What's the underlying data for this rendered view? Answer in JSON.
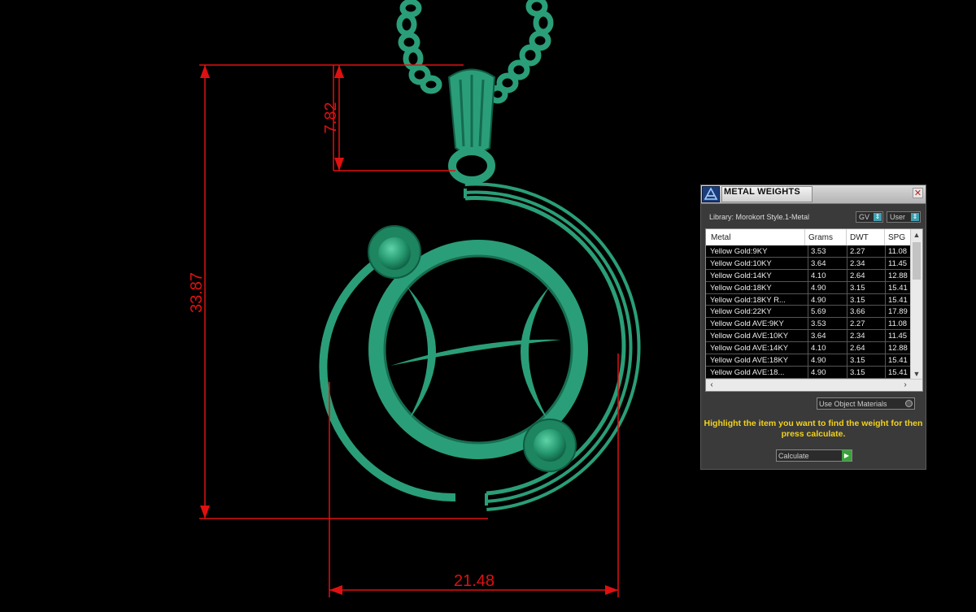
{
  "dimensions": {
    "height_total": "33.87",
    "bail_height": "7.82",
    "width": "21.48"
  },
  "colors": {
    "dimension_red": "#e01010",
    "pendant_green": "#2a9e78",
    "highlight_yellow": "#f2d21c"
  },
  "panel": {
    "title": "METAL WEIGHTS",
    "close_icon": "close-icon",
    "library_label": "Library: Morokort Style.1-Metal",
    "gv_button": "GV",
    "user_button": "User",
    "columns": [
      "Metal",
      "Grams",
      "DWT",
      "SPG"
    ],
    "rows": [
      {
        "metal": "Yellow Gold:9KY",
        "grams": "3.53",
        "dwt": "2.27",
        "spg": "11.08"
      },
      {
        "metal": "Yellow Gold:10KY",
        "grams": "3.64",
        "dwt": "2.34",
        "spg": "11.45"
      },
      {
        "metal": "Yellow Gold:14KY",
        "grams": "4.10",
        "dwt": "2.64",
        "spg": "12.88"
      },
      {
        "metal": "Yellow Gold:18KY",
        "grams": "4.90",
        "dwt": "3.15",
        "spg": "15.41"
      },
      {
        "metal": "Yellow Gold:18KY R...",
        "grams": "4.90",
        "dwt": "3.15",
        "spg": "15.41"
      },
      {
        "metal": "Yellow Gold:22KY",
        "grams": "5.69",
        "dwt": "3.66",
        "spg": "17.89"
      },
      {
        "metal": "Yellow Gold AVE:9KY",
        "grams": "3.53",
        "dwt": "2.27",
        "spg": "11.08"
      },
      {
        "metal": "Yellow Gold AVE:10KY",
        "grams": "3.64",
        "dwt": "2.34",
        "spg": "11.45"
      },
      {
        "metal": "Yellow Gold AVE:14KY",
        "grams": "4.10",
        "dwt": "2.64",
        "spg": "12.88"
      },
      {
        "metal": "Yellow Gold AVE:18KY",
        "grams": "4.90",
        "dwt": "3.15",
        "spg": "15.41"
      },
      {
        "metal": "Yellow Gold AVE:18...",
        "grams": "4.90",
        "dwt": "3.15",
        "spg": "15.41"
      }
    ],
    "use_object_materials": "Use Object Materials",
    "hint": "Highlight the item you want to find the weight for then press calculate.",
    "calculate_button": "Calculate"
  }
}
